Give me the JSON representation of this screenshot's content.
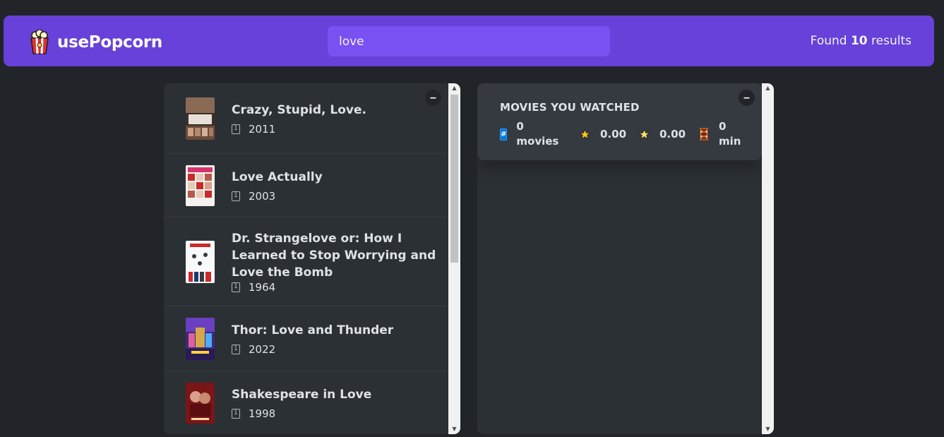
{
  "nav": {
    "logo_text": "usePopcorn",
    "search_value": "love",
    "search_placeholder": "Search movies...",
    "results_prefix": "Found",
    "results_count": "10",
    "results_suffix": "results"
  },
  "list": {
    "toggle_label": "–",
    "movies": [
      {
        "title": "Crazy, Stupid, Love.",
        "year": "2011"
      },
      {
        "title": "Love Actually",
        "year": "2003"
      },
      {
        "title": "Dr. Strangelove or: How I Learned to Stop Worrying and Love the Bomb",
        "year": "1964"
      },
      {
        "title": "Thor: Love and Thunder",
        "year": "2022"
      },
      {
        "title": "Shakespeare in Love",
        "year": "1998"
      }
    ]
  },
  "summary": {
    "toggle_label": "–",
    "title": "Movies you watched",
    "movies_count": "0",
    "movies_unit": "movies",
    "imdb_rating": "0.00",
    "user_rating": "0.00",
    "runtime": "0",
    "runtime_unit": "min"
  },
  "icons": {
    "logo": "popcorn-icon",
    "calendar": "calendar-icon",
    "count": "hash-icon",
    "imdb": "star-icon",
    "user": "glowing-star-icon",
    "runtime": "hourglass-icon"
  },
  "colors": {
    "background": "#212529",
    "nav": "#6741d9",
    "search": "#7950f2",
    "box": "#2b3035",
    "summary": "#343a40"
  }
}
